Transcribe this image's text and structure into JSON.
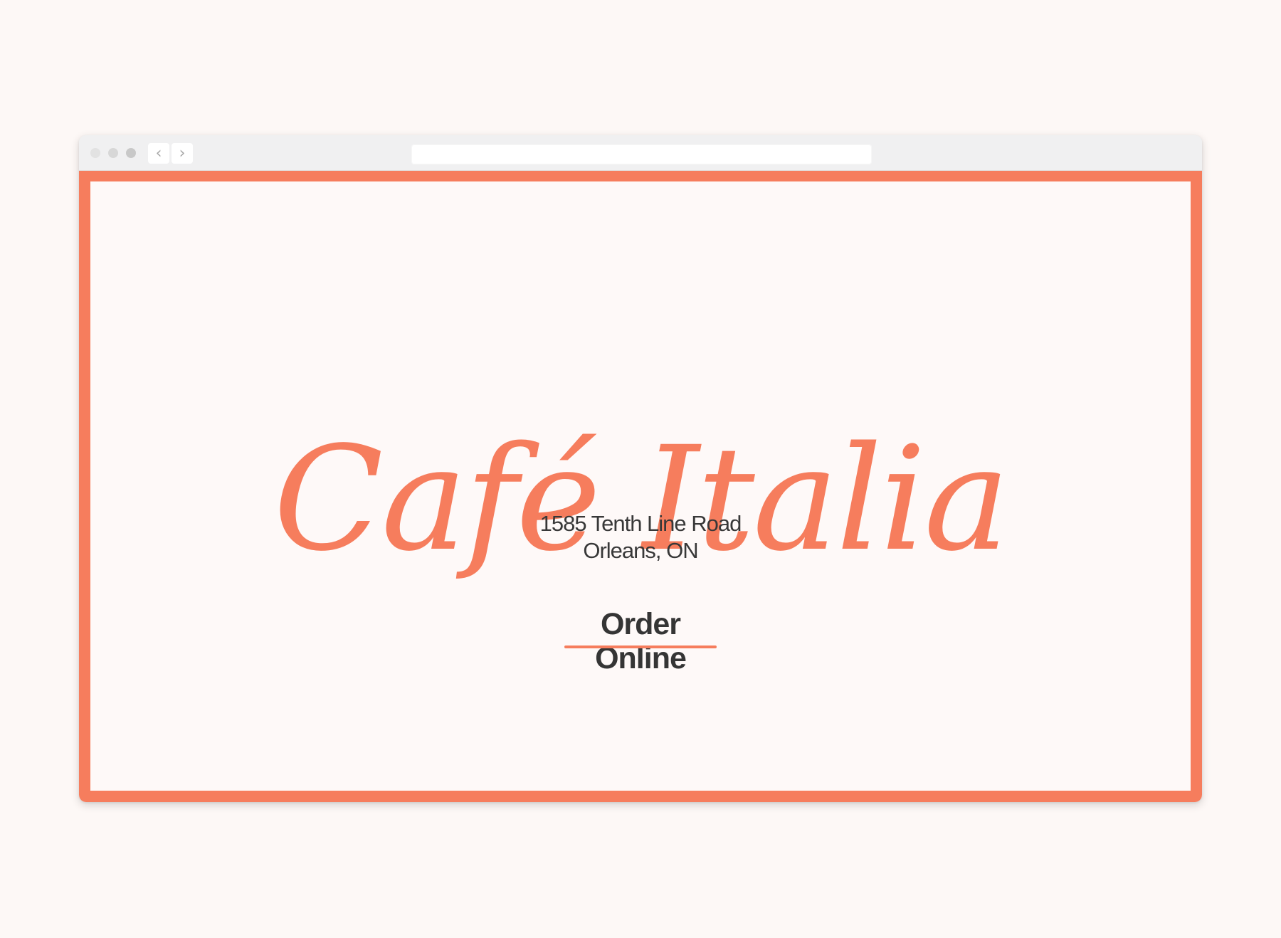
{
  "browser": {
    "navigation": {
      "back_icon": "chevron-left-icon",
      "back_glyph": "‹",
      "forward_icon": "chevron-right-icon",
      "forward_glyph": "›"
    },
    "address_bar": {
      "value": ""
    }
  },
  "page": {
    "title": "Café Italia",
    "address": {
      "line1": "1585 Tenth Line Road",
      "line2": "Orleans, ON"
    },
    "cta": {
      "label": "Order Online"
    }
  },
  "colors": {
    "accent": "#f67d5d",
    "page_background": "#fef9f8",
    "text_dark": "#353535",
    "browser_chrome": "#f0f0f1"
  }
}
